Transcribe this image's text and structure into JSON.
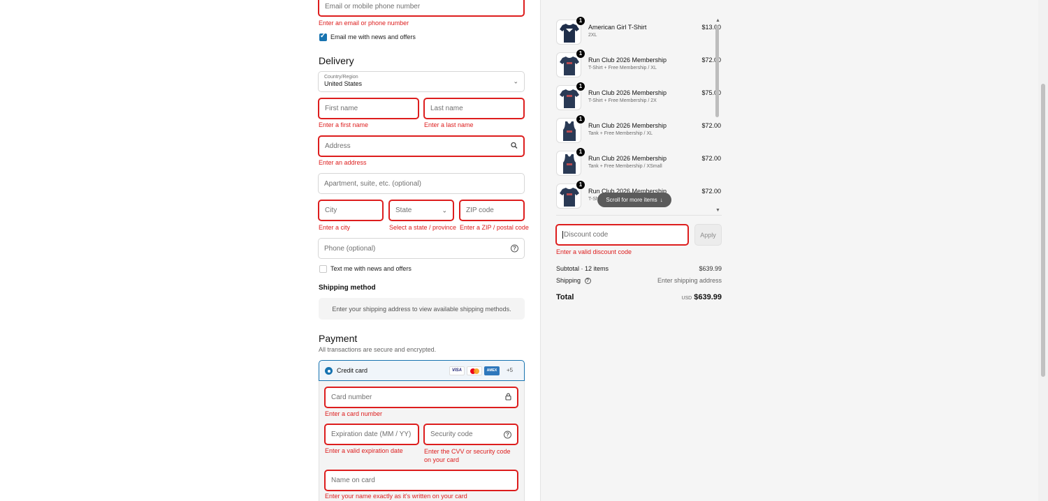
{
  "contact": {
    "email_placeholder": "Email or mobile phone number",
    "email_error": "Enter an email or phone number",
    "news_label": "Email me with news and offers"
  },
  "delivery": {
    "heading": "Delivery",
    "country_label": "Country/Region",
    "country_value": "United States",
    "first_name_placeholder": "First name",
    "first_name_error": "Enter a first name",
    "last_name_placeholder": "Last name",
    "last_name_error": "Enter a last name",
    "address_placeholder": "Address",
    "address_error": "Enter an address",
    "apartment_placeholder": "Apartment, suite, etc. (optional)",
    "city_placeholder": "City",
    "city_error": "Enter a city",
    "state_placeholder": "State",
    "state_error": "Select a state / province",
    "zip_placeholder": "ZIP code",
    "zip_error": "Enter a ZIP / postal code",
    "phone_placeholder": "Phone (optional)",
    "text_label": "Text me with news and offers"
  },
  "shipping": {
    "heading": "Shipping method",
    "notice": "Enter your shipping address to view available shipping methods."
  },
  "payment": {
    "heading": "Payment",
    "subheading": "All transactions are secure and encrypted.",
    "method_label": "Credit card",
    "card_brands": [
      "VISA",
      "MC",
      "AMEX"
    ],
    "more_brands": "+5",
    "card_number_placeholder": "Card number",
    "card_number_error": "Enter a card number",
    "expiry_placeholder": "Expiration date (MM / YY)",
    "expiry_error": "Enter a valid expiration date",
    "cvv_placeholder": "Security code",
    "cvv_error": "Enter the CVV or security code on your card",
    "name_placeholder": "Name on card",
    "name_error": "Enter your name exactly as it's written on your card"
  },
  "cart": {
    "items": [
      {
        "name": "American Girl T-Shirt",
        "variant": "2XL",
        "price": "$13.00",
        "qty": "1",
        "kind": "tee-white-print"
      },
      {
        "name": "Run Club 2026 Membership",
        "variant": "T-Shirt + Free Membership / XL",
        "price": "$72.00",
        "qty": "1",
        "kind": "tee"
      },
      {
        "name": "Run Club 2026 Membership",
        "variant": "T-Shirt + Free Membership / 2X",
        "price": "$75.00",
        "qty": "1",
        "kind": "tee"
      },
      {
        "name": "Run Club 2026 Membership",
        "variant": "Tank + Free Membership / XL",
        "price": "$72.00",
        "qty": "1",
        "kind": "tank"
      },
      {
        "name": "Run Club 2026 Membership",
        "variant": "Tank + Free Membership / XSmall",
        "price": "$72.00",
        "qty": "1",
        "kind": "tank"
      },
      {
        "name": "Run Club 2026 Membership",
        "variant": "T-Sh",
        "price": "$72.00",
        "qty": "1",
        "kind": "tee"
      }
    ],
    "scroll_hint": "Scroll for more items",
    "discount_placeholder": "Discount code",
    "discount_error": "Enter a valid discount code",
    "apply_label": "Apply",
    "subtotal_label": "Subtotal · 12 items",
    "subtotal_value": "$639.99",
    "shipping_label": "Shipping",
    "shipping_value": "Enter shipping address",
    "total_label": "Total",
    "currency": "USD",
    "total_value": "$639.99"
  },
  "colors": {
    "error": "#dd1d1d",
    "accent": "#1773b0",
    "navy_shirt": "#1f2e4a"
  }
}
